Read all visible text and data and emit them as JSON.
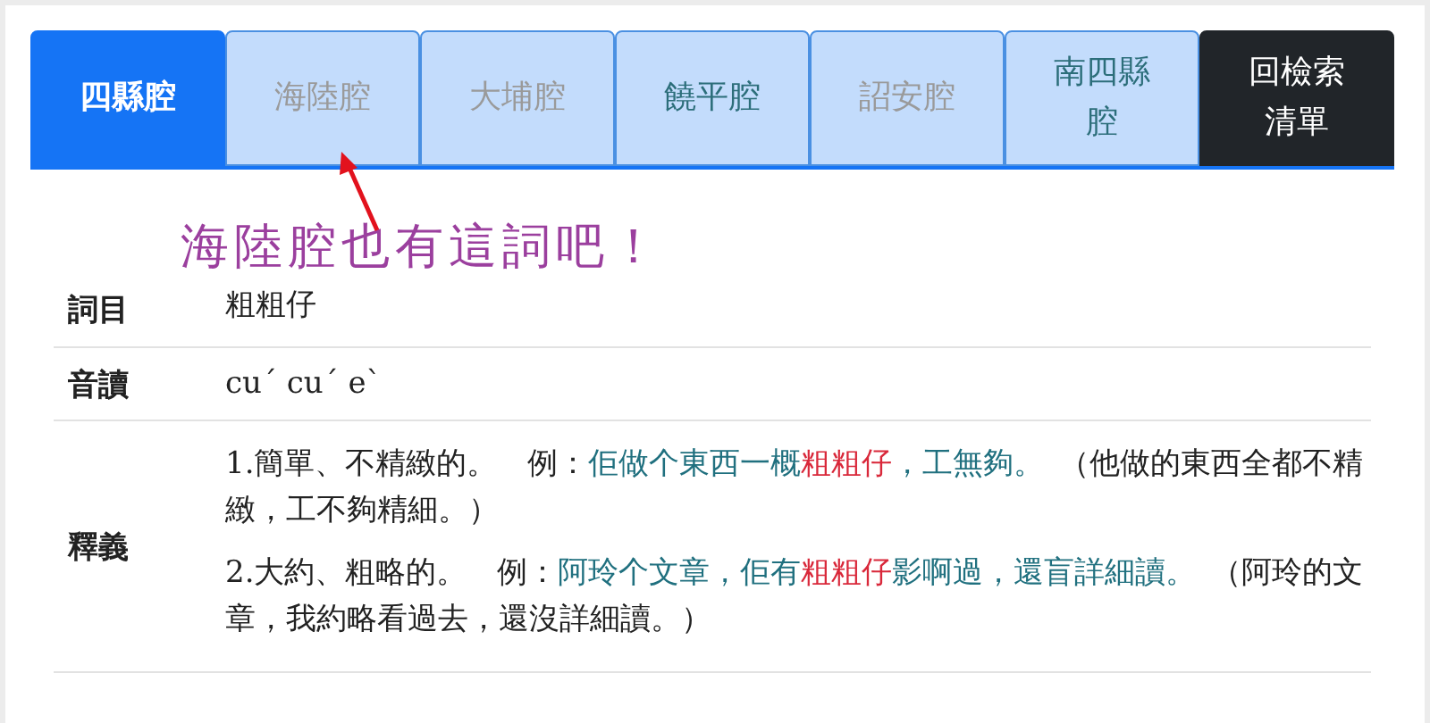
{
  "tabs": [
    {
      "label": "四縣腔",
      "selected": true,
      "disabled": false
    },
    {
      "label": "海陸腔",
      "selected": false,
      "disabled": true
    },
    {
      "label": "大埔腔",
      "selected": false,
      "disabled": true
    },
    {
      "label": "饒平腔",
      "selected": false,
      "disabled": false
    },
    {
      "label": "詔安腔",
      "selected": false,
      "disabled": true
    },
    {
      "label": "南四縣腔",
      "selected": false,
      "disabled": false
    }
  ],
  "back_button": {
    "label": "回檢索清單"
  },
  "annotation": {
    "text": "海陸腔也有這詞吧！"
  },
  "entry": [
    {
      "label": "詞目",
      "kind": "text",
      "value": "粗粗仔"
    },
    {
      "label": "音讀",
      "kind": "text",
      "value": "cu´ cu´ e`"
    },
    {
      "label": "釋義",
      "kind": "definitions",
      "definitions": [
        {
          "meaning": "1.簡單、不精緻的。",
          "example_label": "例：",
          "example": [
            {
              "text": "佢做个東西一概",
              "kind": "example"
            },
            {
              "text": "粗粗仔",
              "kind": "headword"
            },
            {
              "text": "，工無夠。",
              "kind": "example"
            }
          ],
          "translation": "（他做的東西全都不精緻，工不夠精細。）"
        },
        {
          "meaning": "2.大約、粗略的。",
          "example_label": "例：",
          "example": [
            {
              "text": "阿玲个文章，佢有",
              "kind": "example"
            },
            {
              "text": "粗粗仔",
              "kind": "headword"
            },
            {
              "text": "影啊過，還盲詳細讀。",
              "kind": "example"
            }
          ],
          "translation": "（阿玲的文章，我約略看過去，還沒詳細讀。）"
        }
      ]
    }
  ]
}
